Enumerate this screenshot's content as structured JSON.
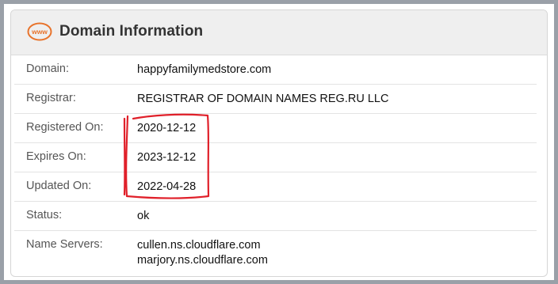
{
  "header": {
    "icon_text": "www",
    "title": "Domain Information"
  },
  "rows": [
    {
      "label": "Domain:",
      "value": "happyfamilymedstore.com"
    },
    {
      "label": "Registrar:",
      "value": "REGISTRAR OF DOMAIN NAMES REG.RU LLC"
    },
    {
      "label": "Registered On:",
      "value": "2020-12-12"
    },
    {
      "label": "Expires On:",
      "value": "2023-12-12"
    },
    {
      "label": "Updated On:",
      "value": "2022-04-28"
    },
    {
      "label": "Status:",
      "value": "ok"
    }
  ],
  "name_servers": {
    "label": "Name Servers:",
    "values": [
      "cullen.ns.cloudflare.com",
      "marjory.ns.cloudflare.com"
    ]
  },
  "colors": {
    "accent": "#e8732b",
    "annotation": "#e0202a"
  }
}
